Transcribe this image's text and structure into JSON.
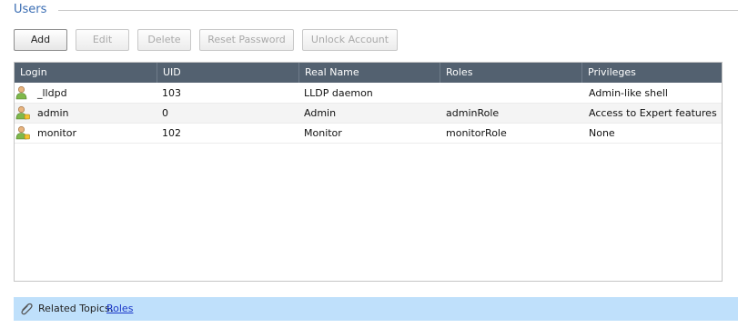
{
  "section": {
    "title": "Users"
  },
  "toolbar": {
    "add_label": "Add",
    "edit_label": "Edit",
    "delete_label": "Delete",
    "reset_password_label": "Reset Password",
    "unlock_account_label": "Unlock Account"
  },
  "table": {
    "columns": [
      "Login",
      "UID",
      "Real Name",
      "Roles",
      "Privileges"
    ],
    "rows": [
      {
        "login": "_lldpd",
        "uid": "103",
        "real_name": "LLDP daemon",
        "roles": "",
        "privileges": "Admin-like shell"
      },
      {
        "login": "admin",
        "uid": "0",
        "real_name": "Admin",
        "roles": "adminRole",
        "privileges": "Access to Expert features"
      },
      {
        "login": "monitor",
        "uid": "102",
        "real_name": "Monitor",
        "roles": "monitorRole",
        "privileges": "None"
      }
    ]
  },
  "related": {
    "label": "Related Topics:",
    "link": "Roles"
  },
  "icons": {
    "user": "user-icon",
    "attachment": "paperclip-icon"
  },
  "colors": {
    "header_bg": "#536170",
    "related_bg": "#bfe0fb",
    "title": "#3a6db3",
    "link": "#1a37c8"
  }
}
